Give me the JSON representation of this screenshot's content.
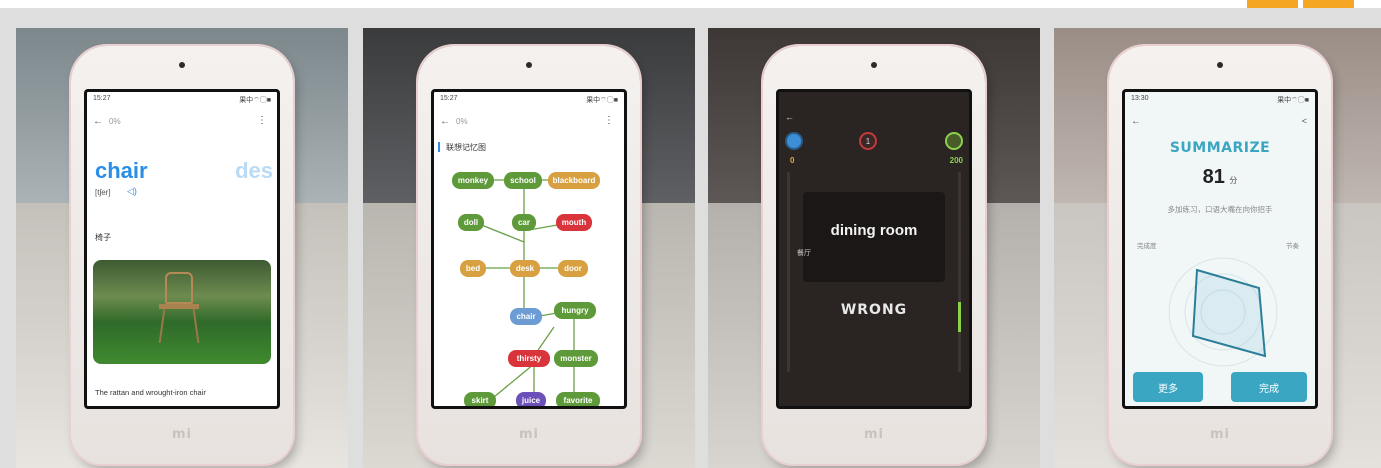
{
  "panel1": {
    "time": "15:27",
    "signal": "果中⌔◯■",
    "progress": "0%",
    "menu": "⋮",
    "word": "chair",
    "next_word": "des",
    "phonetic": "[tʃer]",
    "speaker_icon": "speaker-icon",
    "meaning": "椅子",
    "sentence": "The rattan and wrought-iron chair"
  },
  "panel2": {
    "time": "15:27",
    "signal": "果中⌔◯■",
    "progress": "0%",
    "menu": "⋮",
    "heading": "联想记忆图",
    "nodes": [
      {
        "label": "monkey",
        "color": "green"
      },
      {
        "label": "school",
        "color": "green"
      },
      {
        "label": "blackboard",
        "color": "orange"
      },
      {
        "label": "doll",
        "color": "green"
      },
      {
        "label": "car",
        "color": "green"
      },
      {
        "label": "mouth",
        "color": "red"
      },
      {
        "label": "bed",
        "color": "orange"
      },
      {
        "label": "desk",
        "color": "orange"
      },
      {
        "label": "door",
        "color": "orange"
      },
      {
        "label": "chair",
        "color": "blue"
      },
      {
        "label": "hungry",
        "color": "green"
      },
      {
        "label": "thirsty",
        "color": "red"
      },
      {
        "label": "monster",
        "color": "green"
      },
      {
        "label": "skirt",
        "color": "green"
      },
      {
        "label": "juice",
        "color": "purple"
      },
      {
        "label": "favorite",
        "color": "green"
      }
    ]
  },
  "panel3": {
    "back": "←",
    "left_score": "0",
    "right_score": "200",
    "timer": "1",
    "phrase": "dining room",
    "meaning": "餐厅",
    "result": "WRONG"
  },
  "panel4": {
    "time": "13:30",
    "signal": "果中⌔◯■",
    "back": "←",
    "share": "<",
    "title": "SUMMARIZE",
    "score": "81",
    "score_unit": "分",
    "tip": "多加练习，口语大嘴在向你招手",
    "label_left": "完成度",
    "label_right": "节奏",
    "more_button": "更多",
    "done_button": "完成"
  },
  "device_logo": "mi",
  "colors": {
    "accent_blue": "#2a8ee6",
    "teal": "#3aa6c2",
    "wrong_bar": "#8bd14a"
  }
}
